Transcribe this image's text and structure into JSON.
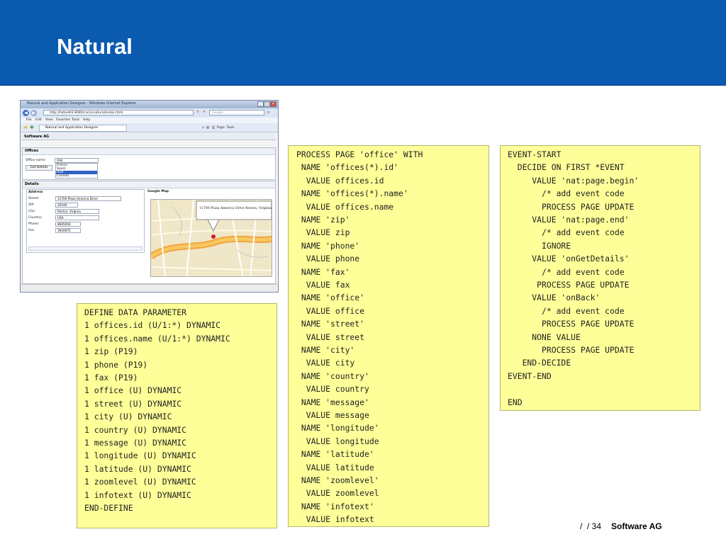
{
  "slide": {
    "title": "Natural",
    "footer_page": "/  / 34",
    "footer_brand": "Software AG"
  },
  "browser": {
    "window_title": "Natural and Application Designer - Windows Internet Explorer",
    "url": "http://hatool03:8080/cis/cisnatural/index.html",
    "search_placeholder": "Google",
    "menu": [
      "File",
      "Edit",
      "View",
      "Favorites",
      "Tools",
      "Help"
    ],
    "tab_title": "Natural and Application Designer",
    "toolbar_page": "Page",
    "toolbar_tools": "Tools"
  },
  "app": {
    "header": "Software AG",
    "offices_title": "Offices",
    "office_name_label": "Office name:",
    "office_name_value": "USA",
    "office_options": [
      "France",
      "Spain",
      "USA",
      "Canada"
    ],
    "get_details_label": "Get Details",
    "details_title": "Details",
    "address_title": "Address",
    "map_title": "Google Map",
    "map_callout": "11700 Plaza America Drive Reston, Virginia",
    "fields": [
      {
        "label": "Street:",
        "value": "11700 Plaza America Drive"
      },
      {
        "label": "ZIP:",
        "value": "20190"
      },
      {
        "label": "City:",
        "value": "Reston, Virginia"
      },
      {
        "label": "Country:",
        "value": "USA"
      },
      {
        "label": "Phone:",
        "value": "8605050"
      },
      {
        "label": "Fax:",
        "value": "3916975"
      }
    ]
  },
  "code": {
    "define": [
      "DEFINE DATA PARAMETER",
      "1 offices.id (U/1:*) DYNAMIC",
      "1 offices.name (U/1:*) DYNAMIC",
      "1 zip (P19)",
      "1 phone (P19)",
      "1 fax (P19)",
      "1 office (U) DYNAMIC",
      "1 street (U) DYNAMIC",
      "1 city (U) DYNAMIC",
      "1 country (U) DYNAMIC",
      "1 message (U) DYNAMIC",
      "1 longitude (U) DYNAMIC",
      "1 latitude (U) DYNAMIC",
      "1 zoomlevel (U) DYNAMIC",
      "1 infotext (U) DYNAMIC",
      "END-DEFINE"
    ],
    "process": [
      "PROCESS PAGE 'office' WITH",
      " NAME 'offices(*).id'",
      "  VALUE offices.id",
      " NAME 'offices(*).name'",
      "  VALUE offices.name",
      " NAME 'zip'",
      "  VALUE zip",
      " NAME 'phone'",
      "  VALUE phone",
      " NAME 'fax'",
      "  VALUE fax",
      " NAME 'office'",
      "  VALUE office",
      " NAME 'street'",
      "  VALUE street",
      " NAME 'city'",
      "  VALUE city",
      " NAME 'country'",
      "  VALUE country",
      " NAME 'message'",
      "  VALUE message",
      " NAME 'longitude'",
      "  VALUE longitude",
      " NAME 'latitude'",
      "  VALUE latitude",
      " NAME 'zoomlevel'",
      "  VALUE zoomlevel",
      " NAME 'infotext'",
      "  VALUE infotext"
    ],
    "event": [
      "EVENT-START",
      "  DECIDE ON FIRST *EVENT",
      "     VALUE 'nat:page.begin'",
      "       /* add event code",
      "       PROCESS PAGE UPDATE",
      "     VALUE 'nat:page.end'",
      "       /* add event code",
      "       IGNORE",
      "     VALUE 'onGetDetails'",
      "       /* add event code",
      "      PROCESS PAGE UPDATE",
      "     VALUE 'onBack'",
      "       /* add event code",
      "       PROCESS PAGE UPDATE",
      "     NONE VALUE",
      "       PROCESS PAGE UPDATE",
      "   END-DECIDE",
      "EVENT-END",
      "",
      "END"
    ]
  }
}
